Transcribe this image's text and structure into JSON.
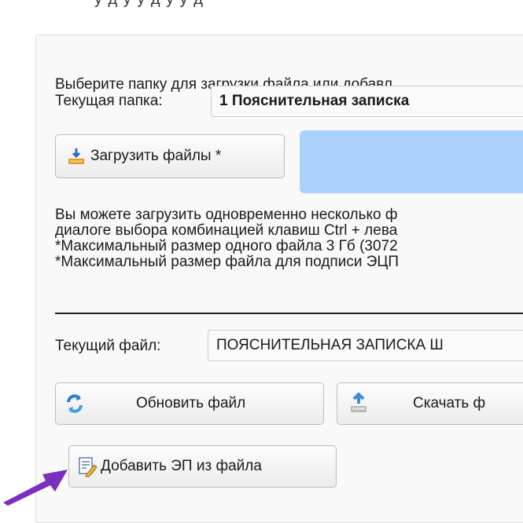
{
  "top_fragment": "у  д у  у  д у  у  д",
  "intro_text": "Выберите папку для загрузки файла или добавл",
  "current_folder": {
    "label": "Текущая папка:",
    "value": "1 Пояснительная записка"
  },
  "upload_button": {
    "label": "Загрузить файлы *"
  },
  "info_lines": [
    "Вы можете загрузить одновременно несколько ф",
    "диалоге выбора комбинацией клавиш Ctrl + лева",
    "*Максимальный размер одного файла 3 Гб (3072",
    "*Максимальный размер файла для подписи ЭЦП"
  ],
  "current_file": {
    "label": "Текущий файл:",
    "value": "ПОЯСНИТЕЛЬНАЯ ЗАПИСКА Ш"
  },
  "refresh_button": {
    "label": "Обновить файл"
  },
  "download_button": {
    "label": "Скачать ф"
  },
  "add_signature_button": {
    "label": "Добавить ЭП из файла"
  },
  "colors": {
    "drop_zone": "#a9d1fb",
    "arrow": "#7a2fc0"
  }
}
